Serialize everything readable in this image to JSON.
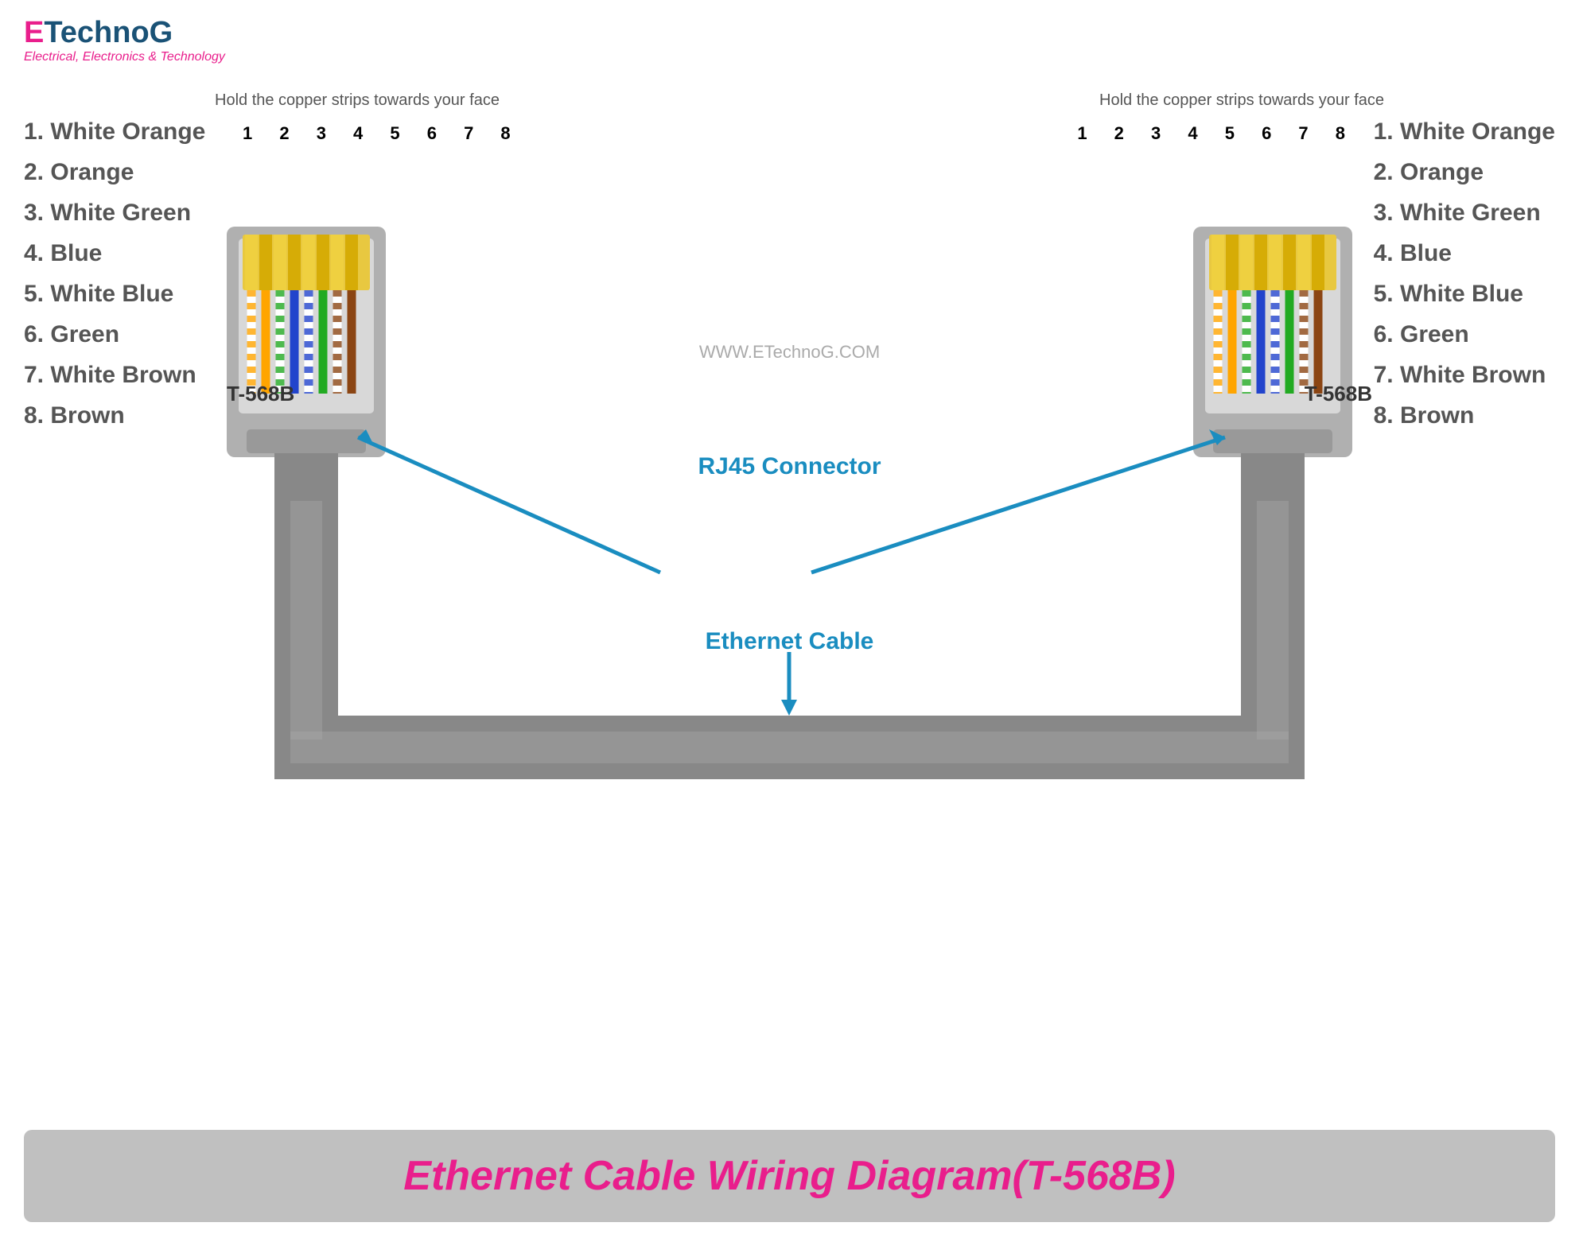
{
  "logo": {
    "e": "E",
    "technog": "TechnoG",
    "tagline": "Electrical, Electronics & Technology"
  },
  "left_wires": [
    "1.  White Orange",
    "2.  Orange",
    "3.  White Green",
    "4.  Blue",
    "5.  White Blue",
    "6.  Green",
    "7. White Brown",
    "8.  Brown"
  ],
  "right_wires": [
    "1.  White Orange",
    "2.  Orange",
    "3.  White Green",
    "4.  Blue",
    "5.  White Blue",
    "6.  Green",
    "7. White Brown",
    "8.  Brown"
  ],
  "instruction": "Hold the copper strips towards your face",
  "pin_numbers": "1 2 3 4 5 6 7 8",
  "label_t568b": "T-568B",
  "rj45_label": "RJ45 Connector",
  "ethernet_label": "Ethernet Cable",
  "watermark": "WWW.ETechnoG.COM",
  "bottom_banner": "Ethernet Cable Wiring Diagram(T-568B)"
}
